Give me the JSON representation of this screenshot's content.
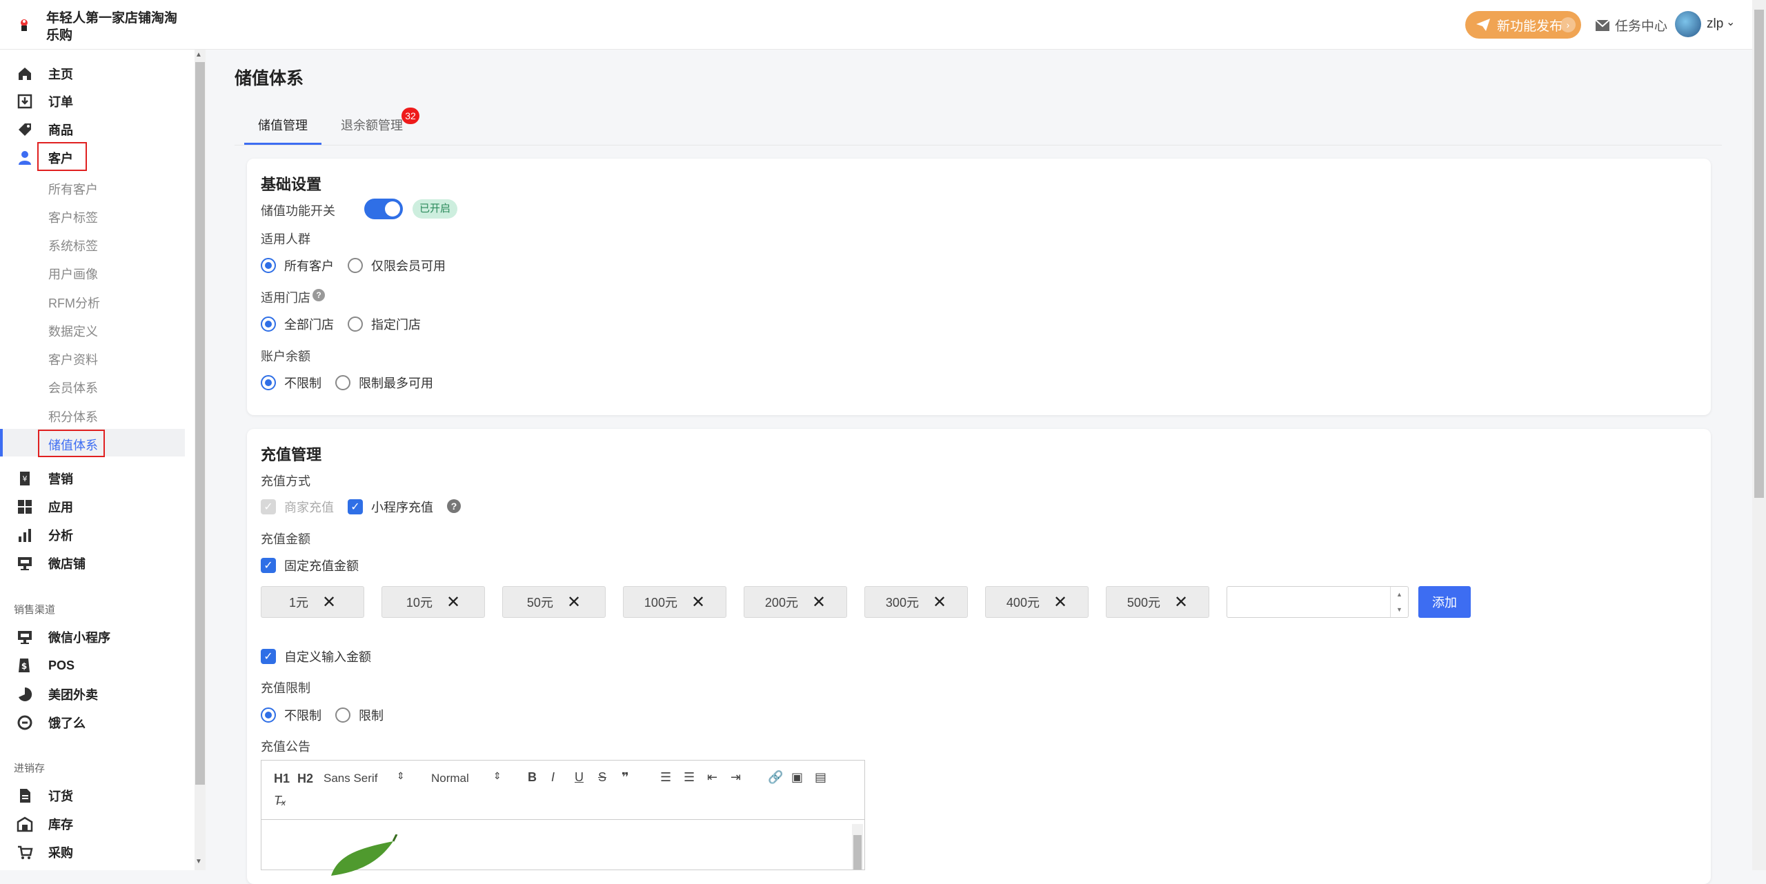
{
  "header": {
    "shop_name": "年轻人第一家店铺淘淘乐购",
    "new_feature_label": "新功能发布",
    "task_center_label": "任务中心",
    "username": "zlp"
  },
  "sidebar": {
    "main_items": [
      {
        "label": "主页",
        "icon": "home-icon"
      },
      {
        "label": "订单",
        "icon": "inbox-download-icon"
      },
      {
        "label": "商品",
        "icon": "tag-icon"
      },
      {
        "label": "客户",
        "icon": "user-icon"
      }
    ],
    "customer_sub_items": [
      "所有客户",
      "客户标签",
      "系统标签",
      "用户画像",
      "RFM分析",
      "数据定义",
      "客户资料",
      "会员体系",
      "积分体系",
      "储值体系"
    ],
    "active_sub_item": "储值体系",
    "more_items": [
      {
        "label": "营销",
        "icon": "voucher-icon"
      },
      {
        "label": "应用",
        "icon": "apps-icon"
      },
      {
        "label": "分析",
        "icon": "bar-chart-icon"
      },
      {
        "label": "微店铺",
        "icon": "shop-display-icon"
      }
    ],
    "sales_channel_title": "销售渠道",
    "sales_channels": [
      {
        "label": "微信小程序",
        "icon": "miniprogram-icon"
      },
      {
        "label": "POS",
        "icon": "dollar-icon"
      },
      {
        "label": "美团外卖",
        "icon": "meituan-icon"
      },
      {
        "label": "饿了么",
        "icon": "eleme-icon"
      }
    ],
    "inventory_title": "进销存",
    "inventory_items": [
      {
        "label": "订货",
        "icon": "document-icon"
      },
      {
        "label": "库存",
        "icon": "warehouse-icon"
      },
      {
        "label": "采购",
        "icon": "cart-icon"
      }
    ]
  },
  "page": {
    "title": "储值体系",
    "tabs": [
      {
        "label": "储值管理",
        "active": true
      },
      {
        "label": "退余额管理",
        "badge": "32"
      }
    ]
  },
  "basic": {
    "title": "基础设置",
    "switch_label": "储值功能开关",
    "switch_on": true,
    "switch_tag": "已开启",
    "audience_label": "适用人群",
    "audience_options": [
      "所有客户",
      "仅限会员可用"
    ],
    "audience_selected": "所有客户",
    "store_label": "适用门店",
    "store_options": [
      "全部门店",
      "指定门店"
    ],
    "store_selected": "全部门店",
    "balance_label": "账户余额",
    "balance_options": [
      "不限制",
      "限制最多可用"
    ],
    "balance_selected": "不限制"
  },
  "recharge": {
    "title": "充值管理",
    "method_label": "充值方式",
    "method_merchant": "商家充值",
    "method_miniprogram": "小程序充值",
    "amount_label": "充值金额",
    "fixed_amount_label": "固定充值金额",
    "fixed_amounts": [
      "1元",
      "10元",
      "50元",
      "100元",
      "200元",
      "300元",
      "400元",
      "500元"
    ],
    "add_input_value": "",
    "add_button": "添加",
    "custom_amount_label": "自定义输入金额",
    "limit_label": "充值限制",
    "limit_options": [
      "不限制",
      "限制"
    ],
    "limit_selected": "不限制",
    "notice_label": "充值公告",
    "editor": {
      "font_family": "Sans Serif",
      "font_size": "Normal",
      "heading1": "H1",
      "heading2": "H2"
    }
  },
  "colors": {
    "accent": "#3d6df2",
    "pill": "#f0a453",
    "badge": "#ee1b1b",
    "tag_bg": "#cdeede"
  }
}
